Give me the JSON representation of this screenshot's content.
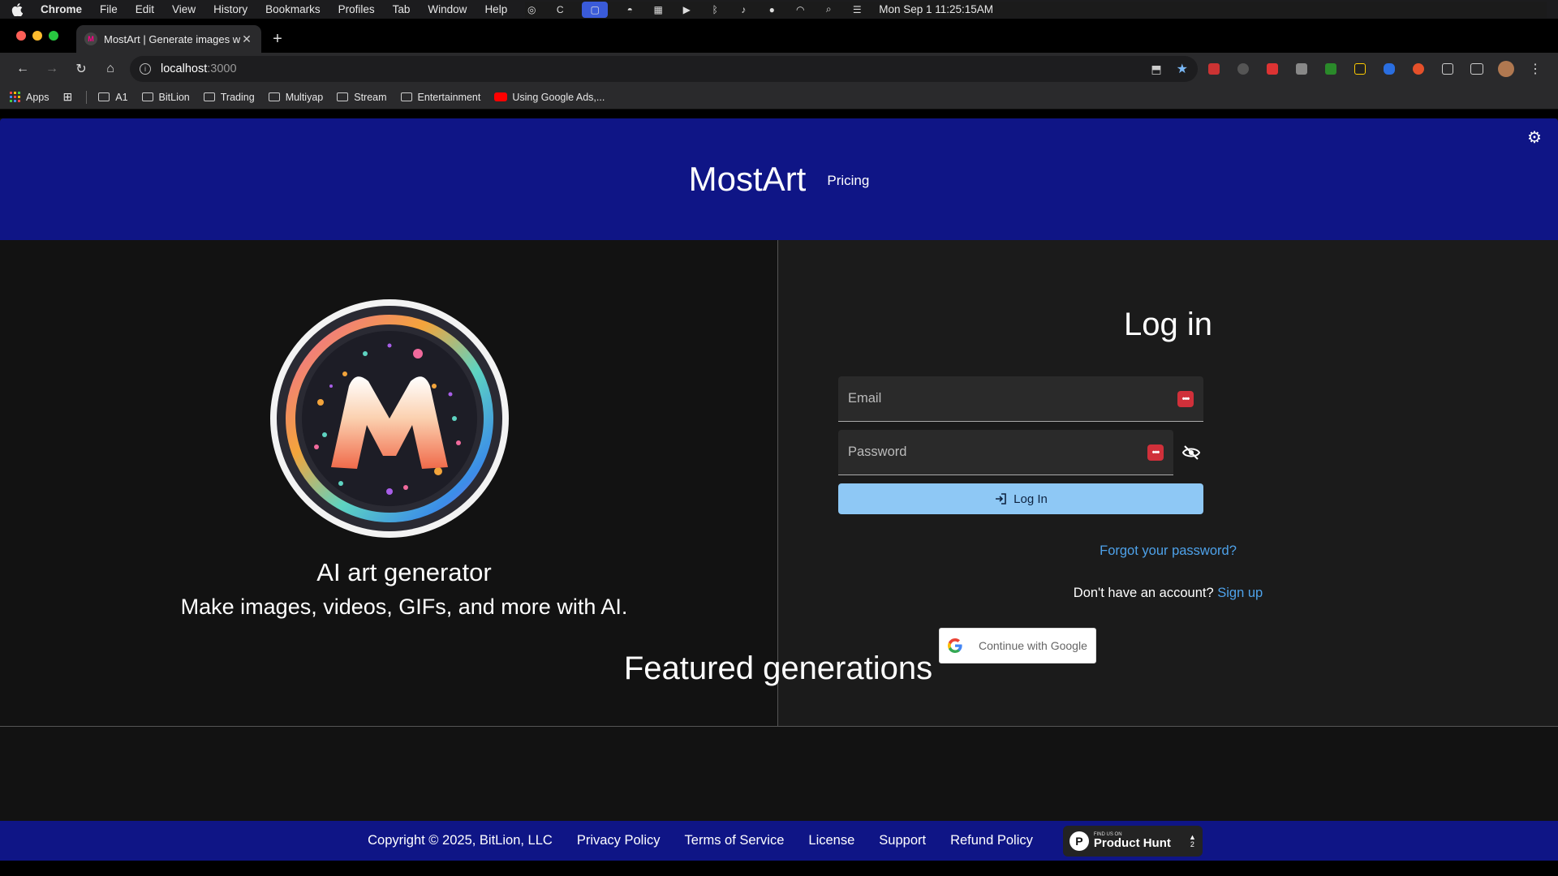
{
  "menubar": {
    "app": "Chrome",
    "items": [
      "File",
      "Edit",
      "View",
      "History",
      "Bookmarks",
      "Profiles",
      "Tab",
      "Window",
      "Help"
    ],
    "clock": "Mon Sep 1  11:25:15AM"
  },
  "browser": {
    "tab_title": "MostArt | Generate images w",
    "url_host": "localhost",
    "url_port": ":3000",
    "bookmarks": [
      "Apps",
      "A1",
      "BitLion",
      "Trading",
      "Multiyap",
      "Stream",
      "Entertainment",
      "Using Google Ads,..."
    ]
  },
  "header": {
    "brand": "MostArt",
    "nav_pricing": "Pricing"
  },
  "hero": {
    "logo_letter": "M",
    "title": "AI art generator",
    "subtitle": "Make images, videos, GIFs, and more with AI."
  },
  "login": {
    "title": "Log in",
    "email_placeholder": "Email",
    "password_placeholder": "Password",
    "login_button": "Log In",
    "forgot_password": "Forgot your password?",
    "no_account": "Don't have an account?",
    "signup": "Sign up",
    "google_button": "Continue with Google"
  },
  "featured": {
    "title": "Featured generations"
  },
  "footer": {
    "copyright": "Copyright © 2025, BitLion, LLC",
    "links": [
      "Privacy Policy",
      "Terms of Service",
      "License",
      "Support",
      "Refund Policy"
    ],
    "product_hunt_small": "FIND US ON",
    "product_hunt_big": "Product Hunt",
    "product_hunt_votes": "2"
  },
  "colors": {
    "header_bg": "#0f1586",
    "login_button_bg": "#8ec8f5",
    "link": "#4ea2ea"
  }
}
